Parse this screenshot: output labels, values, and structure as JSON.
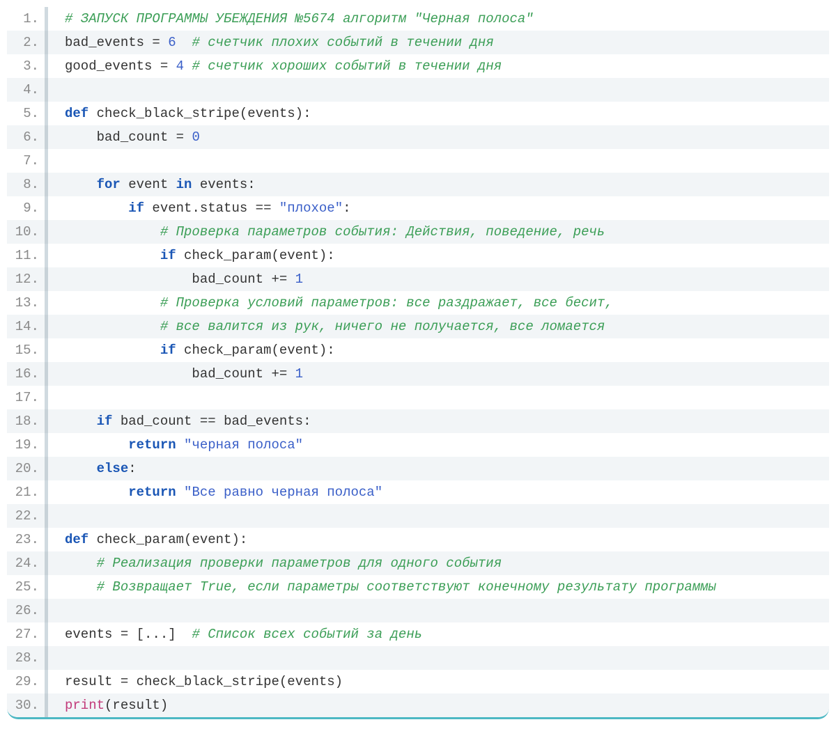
{
  "code": {
    "lines": [
      {
        "n": "1.",
        "striped": false,
        "tokens": [
          {
            "cls": "tok-comment",
            "t": "# ЗАПУСК ПРОГРАММЫ УБЕЖДЕНИЯ №5674 алгоритм \"Черная полоса\""
          }
        ]
      },
      {
        "n": "2.",
        "striped": true,
        "tokens": [
          {
            "cls": "tok-ident",
            "t": "bad_events "
          },
          {
            "cls": "tok-op",
            "t": "= "
          },
          {
            "cls": "tok-number",
            "t": "6"
          },
          {
            "cls": "tok-ident",
            "t": "  "
          },
          {
            "cls": "tok-comment",
            "t": "# счетчик плохих событий в течении дня"
          }
        ]
      },
      {
        "n": "3.",
        "striped": false,
        "tokens": [
          {
            "cls": "tok-ident",
            "t": "good_events "
          },
          {
            "cls": "tok-op",
            "t": "= "
          },
          {
            "cls": "tok-number",
            "t": "4"
          },
          {
            "cls": "tok-ident",
            "t": " "
          },
          {
            "cls": "tok-comment",
            "t": "# счетчик хороших событий в течении дня"
          }
        ]
      },
      {
        "n": "4.",
        "striped": true,
        "tokens": []
      },
      {
        "n": "5.",
        "striped": false,
        "tokens": [
          {
            "cls": "tok-keyword",
            "t": "def"
          },
          {
            "cls": "tok-ident",
            "t": " check_black_stripe(events):"
          }
        ]
      },
      {
        "n": "6.",
        "striped": true,
        "tokens": [
          {
            "cls": "tok-ident",
            "t": "    bad_count "
          },
          {
            "cls": "tok-op",
            "t": "= "
          },
          {
            "cls": "tok-number",
            "t": "0"
          }
        ]
      },
      {
        "n": "7.",
        "striped": false,
        "tokens": []
      },
      {
        "n": "8.",
        "striped": true,
        "tokens": [
          {
            "cls": "tok-ident",
            "t": "    "
          },
          {
            "cls": "tok-keyword",
            "t": "for"
          },
          {
            "cls": "tok-ident",
            "t": " event "
          },
          {
            "cls": "tok-keyword",
            "t": "in"
          },
          {
            "cls": "tok-ident",
            "t": " events:"
          }
        ]
      },
      {
        "n": "9.",
        "striped": false,
        "tokens": [
          {
            "cls": "tok-ident",
            "t": "        "
          },
          {
            "cls": "tok-keyword",
            "t": "if"
          },
          {
            "cls": "tok-ident",
            "t": " event.status "
          },
          {
            "cls": "tok-op",
            "t": "== "
          },
          {
            "cls": "tok-string",
            "t": "\"плохое\""
          },
          {
            "cls": "tok-ident",
            "t": ":"
          }
        ]
      },
      {
        "n": "10.",
        "striped": true,
        "tokens": [
          {
            "cls": "tok-ident",
            "t": "            "
          },
          {
            "cls": "tok-comment",
            "t": "# Проверка параметров события: Действия, поведение, речь"
          }
        ]
      },
      {
        "n": "11.",
        "striped": false,
        "tokens": [
          {
            "cls": "tok-ident",
            "t": "            "
          },
          {
            "cls": "tok-keyword",
            "t": "if"
          },
          {
            "cls": "tok-ident",
            "t": " check_param(event):"
          }
        ]
      },
      {
        "n": "12.",
        "striped": true,
        "tokens": [
          {
            "cls": "tok-ident",
            "t": "                bad_count "
          },
          {
            "cls": "tok-op",
            "t": "+= "
          },
          {
            "cls": "tok-number",
            "t": "1"
          }
        ]
      },
      {
        "n": "13.",
        "striped": false,
        "tokens": [
          {
            "cls": "tok-ident",
            "t": "            "
          },
          {
            "cls": "tok-comment",
            "t": "# Проверка условий параметров: все раздражает, все бесит,"
          }
        ]
      },
      {
        "n": "14.",
        "striped": true,
        "tokens": [
          {
            "cls": "tok-ident",
            "t": "            "
          },
          {
            "cls": "tok-comment",
            "t": "# все валится из рук, ничего не получается, все ломается"
          }
        ]
      },
      {
        "n": "15.",
        "striped": false,
        "tokens": [
          {
            "cls": "tok-ident",
            "t": "            "
          },
          {
            "cls": "tok-keyword",
            "t": "if"
          },
          {
            "cls": "tok-ident",
            "t": " check_param(event):"
          }
        ]
      },
      {
        "n": "16.",
        "striped": true,
        "tokens": [
          {
            "cls": "tok-ident",
            "t": "                bad_count "
          },
          {
            "cls": "tok-op",
            "t": "+= "
          },
          {
            "cls": "tok-number",
            "t": "1"
          }
        ]
      },
      {
        "n": "17.",
        "striped": false,
        "tokens": []
      },
      {
        "n": "18.",
        "striped": true,
        "tokens": [
          {
            "cls": "tok-ident",
            "t": "    "
          },
          {
            "cls": "tok-keyword",
            "t": "if"
          },
          {
            "cls": "tok-ident",
            "t": " bad_count "
          },
          {
            "cls": "tok-op",
            "t": "== "
          },
          {
            "cls": "tok-ident",
            "t": "bad_events:"
          }
        ]
      },
      {
        "n": "19.",
        "striped": false,
        "tokens": [
          {
            "cls": "tok-ident",
            "t": "        "
          },
          {
            "cls": "tok-keyword",
            "t": "return"
          },
          {
            "cls": "tok-ident",
            "t": " "
          },
          {
            "cls": "tok-string",
            "t": "\"черная полоса\""
          }
        ]
      },
      {
        "n": "20.",
        "striped": true,
        "tokens": [
          {
            "cls": "tok-ident",
            "t": "    "
          },
          {
            "cls": "tok-keyword",
            "t": "else"
          },
          {
            "cls": "tok-ident",
            "t": ":"
          }
        ]
      },
      {
        "n": "21.",
        "striped": false,
        "tokens": [
          {
            "cls": "tok-ident",
            "t": "        "
          },
          {
            "cls": "tok-keyword",
            "t": "return"
          },
          {
            "cls": "tok-ident",
            "t": " "
          },
          {
            "cls": "tok-string",
            "t": "\"Все равно черная полоса\""
          }
        ]
      },
      {
        "n": "22.",
        "striped": true,
        "tokens": []
      },
      {
        "n": "23.",
        "striped": false,
        "tokens": [
          {
            "cls": "tok-keyword",
            "t": "def"
          },
          {
            "cls": "tok-ident",
            "t": " check_param(event):"
          }
        ]
      },
      {
        "n": "24.",
        "striped": true,
        "tokens": [
          {
            "cls": "tok-ident",
            "t": "    "
          },
          {
            "cls": "tok-comment",
            "t": "# Реализация проверки параметров для одного события"
          }
        ]
      },
      {
        "n": "25.",
        "striped": false,
        "tokens": [
          {
            "cls": "tok-ident",
            "t": "    "
          },
          {
            "cls": "tok-comment",
            "t": "# Возвращает True, если параметры соответствуют конечному результату программы"
          }
        ]
      },
      {
        "n": "26.",
        "striped": true,
        "tokens": []
      },
      {
        "n": "27.",
        "striped": false,
        "tokens": [
          {
            "cls": "tok-ident",
            "t": "events "
          },
          {
            "cls": "tok-op",
            "t": "= "
          },
          {
            "cls": "tok-ident",
            "t": "[...]  "
          },
          {
            "cls": "tok-comment",
            "t": "# Список всех событий за день"
          }
        ]
      },
      {
        "n": "28.",
        "striped": true,
        "tokens": []
      },
      {
        "n": "29.",
        "striped": false,
        "tokens": [
          {
            "cls": "tok-ident",
            "t": "result "
          },
          {
            "cls": "tok-op",
            "t": "= "
          },
          {
            "cls": "tok-ident",
            "t": "check_black_stripe(events)"
          }
        ]
      },
      {
        "n": "30.",
        "striped": true,
        "tokens": [
          {
            "cls": "tok-builtin",
            "t": "print"
          },
          {
            "cls": "tok-ident",
            "t": "(result)"
          }
        ]
      }
    ]
  }
}
